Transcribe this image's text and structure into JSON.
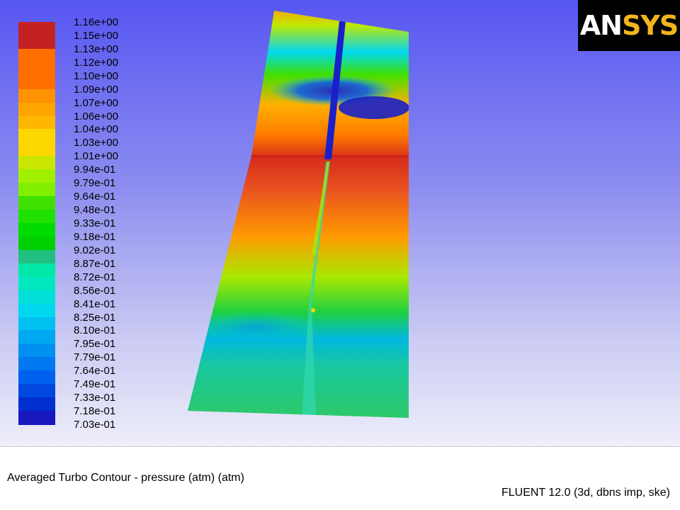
{
  "chart_data": {
    "type": "heatmap",
    "title": "Averaged Turbo Contour - pressure (atm) (atm)",
    "variable": "pressure",
    "unit": "atm",
    "color_range": [
      0.703,
      1.16
    ],
    "legend": {
      "placement": "left",
      "ticks": [
        "1.16e+00",
        "1.15e+00",
        "1.13e+00",
        "1.12e+00",
        "1.10e+00",
        "1.09e+00",
        "1.07e+00",
        "1.06e+00",
        "1.04e+00",
        "1.03e+00",
        "1.01e+00",
        "9.94e-01",
        "9.79e-01",
        "9.64e-01",
        "9.48e-01",
        "9.33e-01",
        "9.18e-01",
        "9.02e-01",
        "8.87e-01",
        "8.72e-01",
        "8.56e-01",
        "8.41e-01",
        "8.25e-01",
        "8.10e-01",
        "7.95e-01",
        "7.79e-01",
        "7.64e-01",
        "7.49e-01",
        "7.33e-01",
        "7.18e-01",
        "7.03e-01"
      ],
      "band_colors": [
        "#c42222",
        "#c42222",
        "#ff6f00",
        "#ff6f00",
        "#ff6f00",
        "#ff9200",
        "#ffa500",
        "#ffb700",
        "#ffd700",
        "#ffd700",
        "#c8e600",
        "#a0f000",
        "#80f000",
        "#40e000",
        "#20e000",
        "#00dc00",
        "#00d000",
        "#20c080",
        "#00e8a8",
        "#00e8c0",
        "#00e0d8",
        "#00d8f0",
        "#00c0f0",
        "#00a8f0",
        "#0090f0",
        "#0078f0",
        "#0060f0",
        "#0048e0",
        "#0030d0",
        "#1818c0"
      ]
    }
  },
  "branding": {
    "logo_text_a": "AN",
    "logo_text_b": "SYS"
  },
  "footer": {
    "title": "Averaged Turbo Contour - pressure (atm) (atm)",
    "solver_info": "FLUENT 12.0 (3d, dbns imp, ske)"
  }
}
